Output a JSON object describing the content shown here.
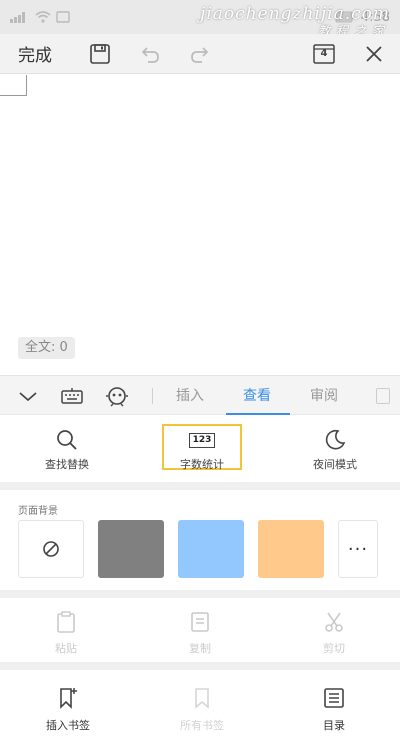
{
  "status_bar": {
    "time": "4:58"
  },
  "watermark": {
    "line1": "jiaochengzhijia.com",
    "line2": "教程之家"
  },
  "toolbar": {
    "done_label": "完成",
    "page_count": "4"
  },
  "document": {
    "word_count_label": "全文: 0"
  },
  "tabs": [
    {
      "label": "插入"
    },
    {
      "label": "查看"
    },
    {
      "label": "审阅"
    }
  ],
  "view_tools": [
    {
      "label": "查找替换",
      "icon": "search-icon"
    },
    {
      "label": "字数统计",
      "icon_text": "123",
      "icon": "word-count-icon"
    },
    {
      "label": "夜间模式",
      "icon": "moon-icon"
    }
  ],
  "page_background": {
    "title": "页面背景",
    "swatches": [
      "#ffffff",
      "#808080",
      "#92c8fe",
      "#fec98b"
    ],
    "more_label": "···"
  },
  "edit_actions": [
    {
      "label": "粘贴",
      "icon": "paste-icon"
    },
    {
      "label": "复制",
      "icon": "copy-icon"
    },
    {
      "label": "剪切",
      "icon": "cut-icon"
    }
  ],
  "bottom_actions": [
    {
      "label": "插入书签",
      "icon": "bookmark-add-icon"
    },
    {
      "label": "所有书签",
      "icon": "bookmark-icon"
    },
    {
      "label": "目录",
      "icon": "toc-icon"
    }
  ],
  "colors": {
    "accent": "#3a8ee6",
    "highlight": "#f2c437"
  }
}
